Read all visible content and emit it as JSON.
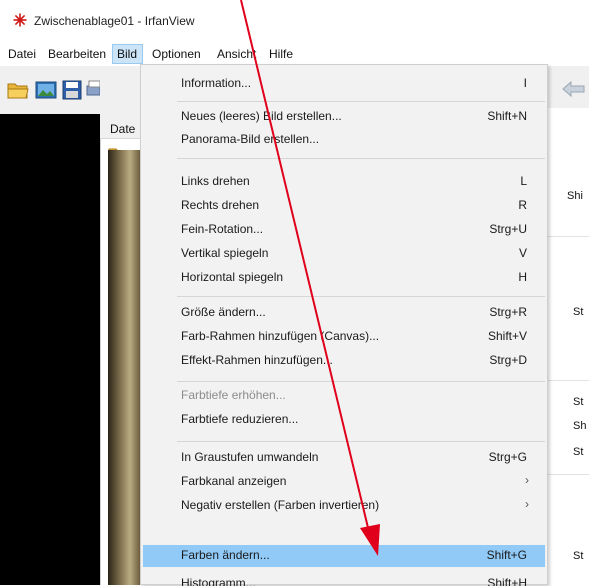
{
  "window": {
    "title": "Zwischenablage01 - IrfanView",
    "app_icon": "irfanview-logo"
  },
  "menubar": {
    "items": [
      {
        "label": "Datei",
        "active": false
      },
      {
        "label": "Bearbeiten",
        "active": false
      },
      {
        "label": "Bild",
        "active": true
      },
      {
        "label": "Optionen",
        "active": false
      },
      {
        "label": "Ansicht",
        "active": false
      },
      {
        "label": "Hilfe",
        "active": false
      }
    ]
  },
  "toolbar": {
    "icons": [
      "open-folder-icon",
      "image-icon",
      "save-icon",
      "print-icon",
      "back-arrow-icon"
    ]
  },
  "background": {
    "dialog_label": "Date",
    "right_shortcuts": [
      "Shi",
      "St",
      "St",
      "Sh",
      "St",
      "St"
    ]
  },
  "dropdown": {
    "groups": [
      [
        {
          "label": "Information...",
          "shortcut": "I"
        }
      ],
      [
        {
          "label": "Neues (leeres) Bild erstellen...",
          "shortcut": "Shift+N"
        },
        {
          "label": "Panorama-Bild erstellen...",
          "shortcut": ""
        }
      ],
      [
        {
          "label": "Links drehen",
          "shortcut": "L"
        },
        {
          "label": "Rechts drehen",
          "shortcut": "R"
        },
        {
          "label": "Fein-Rotation...",
          "shortcut": "Strg+U"
        },
        {
          "label": "Vertikal spiegeln",
          "shortcut": "V"
        },
        {
          "label": "Horizontal spiegeln",
          "shortcut": "H"
        }
      ],
      [
        {
          "label": "Größe ändern...",
          "shortcut": "Strg+R"
        },
        {
          "label": "Farb-Rahmen hinzufügen (Canvas)...",
          "shortcut": "Shift+V"
        },
        {
          "label": "Effekt-Rahmen hinzufügen...",
          "shortcut": "Strg+D"
        }
      ],
      [
        {
          "label": "Farbtiefe erhöhen...",
          "shortcut": "",
          "disabled": true
        },
        {
          "label": "Farbtiefe reduzieren...",
          "shortcut": ""
        }
      ],
      [
        {
          "label": "In Graustufen umwandeln",
          "shortcut": "Strg+G"
        },
        {
          "label": "Farbkanal anzeigen",
          "shortcut": "",
          "submenu": true
        },
        {
          "label": "Negativ erstellen (Farben invertieren)",
          "shortcut": "",
          "submenu": true
        },
        {
          "label": "Farben ändern...",
          "shortcut": "Shift+G",
          "highlighted": true
        },
        {
          "label": "Histogramm...",
          "shortcut": "Shift+H"
        }
      ]
    ],
    "highlight_color": "#91c9f7"
  },
  "annotation": {
    "arrow_color": "#e0001b"
  }
}
